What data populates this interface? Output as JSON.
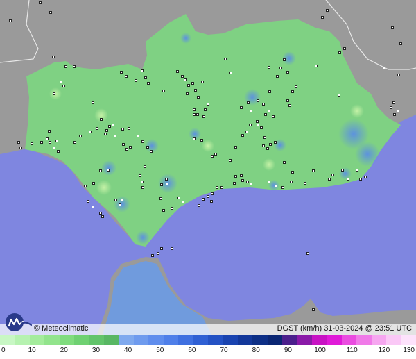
{
  "map": {
    "credit": "© Meteoclimatic",
    "variable_label": "DGST (km/h)",
    "timestamp": "31-03-2024 @ 23:51 UTC",
    "colors": {
      "sea": "#7f86e0",
      "land_outside": "#9a9a9a",
      "region_fill": "#7fd183",
      "strait_fill": "#6e9be0",
      "station_marker": "#111111"
    }
  },
  "legend": {
    "ticks": [
      "0",
      "10",
      "20",
      "30",
      "40",
      "50",
      "60",
      "70",
      "80",
      "90",
      "100",
      "110",
      "120",
      "130"
    ],
    "colors": [
      "#c8f7c4",
      "#b6f2b0",
      "#a4ec9c",
      "#92e48c",
      "#80dc7e",
      "#6fd172",
      "#62c46a",
      "#58b763",
      "#7fa9ee",
      "#6f9bee",
      "#5f8ded",
      "#4f7fe9",
      "#3f70e0",
      "#2f60d4",
      "#2452c4",
      "#1a44b0",
      "#13389a",
      "#0d2f86",
      "#0a2673",
      "#4b1f8c",
      "#8a1aa8",
      "#c813c4",
      "#e01ad8",
      "#ea4ce0",
      "#f07ae8",
      "#f6a6f0",
      "#fac8f6",
      "#fde2fb"
    ]
  }
}
